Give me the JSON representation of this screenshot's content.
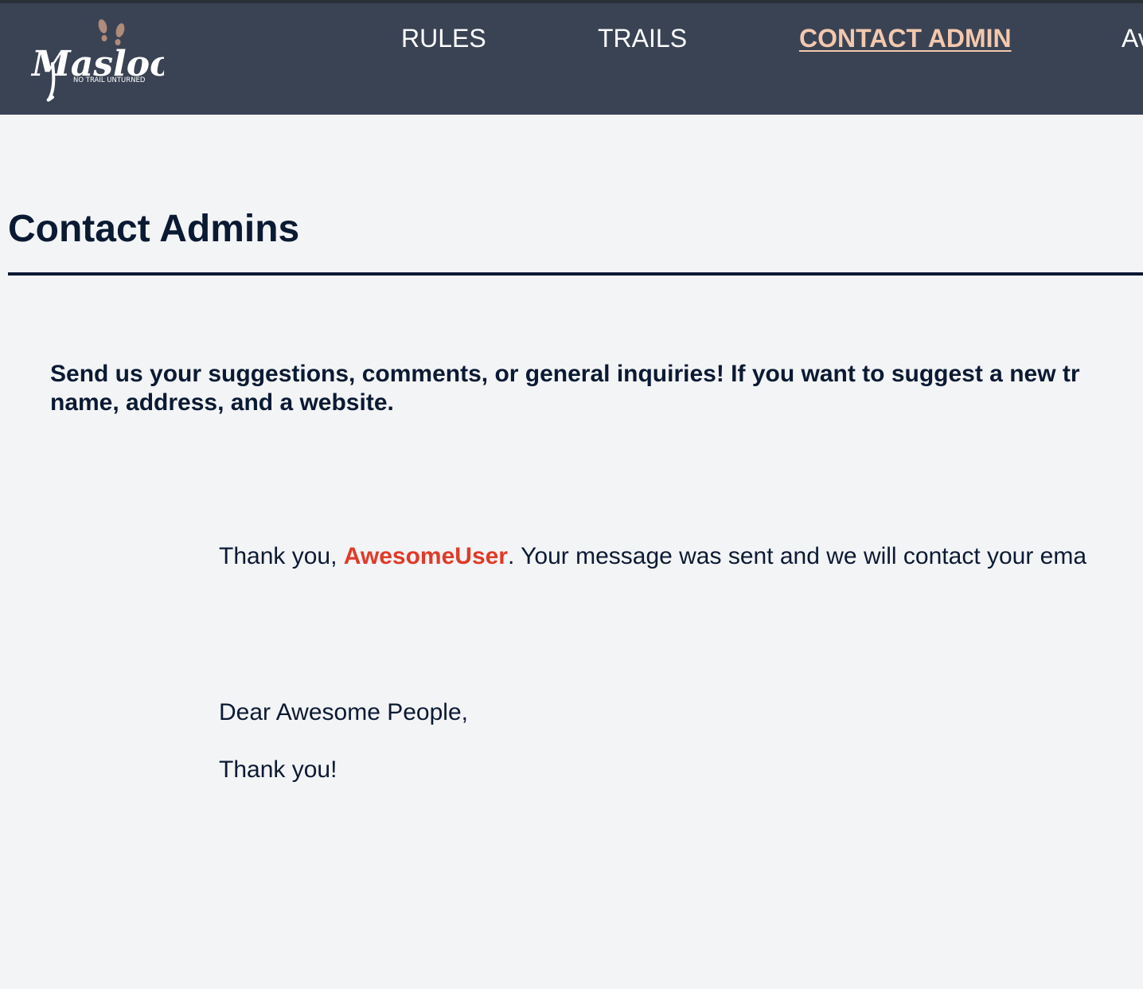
{
  "header": {
    "logo": {
      "wordmark": "Maslool",
      "tagline": "NO TRAIL UNTURNED",
      "icon": "footprints-icon"
    },
    "nav": [
      {
        "label": "RULES",
        "active": false
      },
      {
        "label": "TRAILS",
        "active": false
      },
      {
        "label": "CONTACT ADMIN",
        "active": true
      },
      {
        "label": "Av",
        "active": false
      }
    ]
  },
  "colors": {
    "header_bg": "#3a4354",
    "page_bg": "#f3f4f6",
    "text": "#0b1a33",
    "active_nav": "#f3c8ad",
    "username": "#e03a27"
  },
  "main": {
    "title": "Contact Admins",
    "intro_line1": "Send us your suggestions, comments, or general inquiries! If you want to suggest a new tr",
    "intro_line2": "name, address, and a website.",
    "confirmation": {
      "prefix": "Thank you, ",
      "username": "AwesomeUser",
      "suffix": ". Your message was sent and we will contact your ema"
    },
    "message": {
      "greeting": "Dear Awesome People,",
      "body": "Thank you!"
    }
  }
}
